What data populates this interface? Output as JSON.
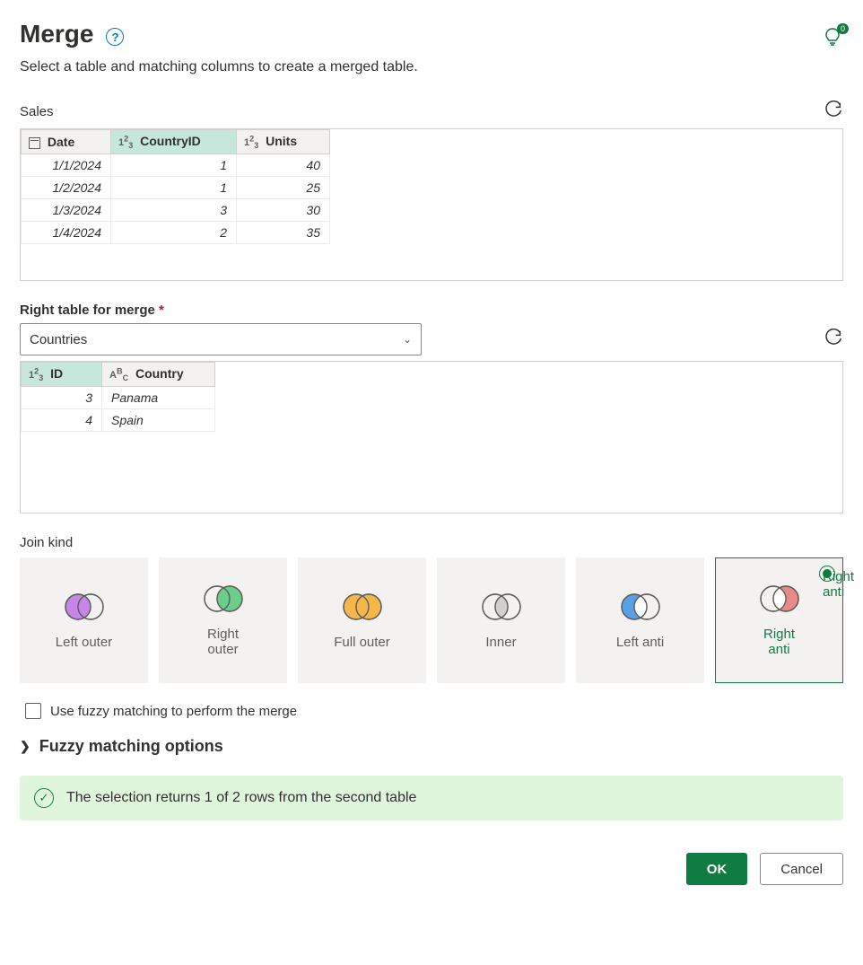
{
  "header": {
    "title": "Merge",
    "subtitle": "Select a table and matching columns to create a merged table.",
    "tip_badge": "0"
  },
  "left_table": {
    "label": "Sales",
    "columns": [
      {
        "name": "Date",
        "type": "date",
        "selected": false
      },
      {
        "name": "CountryID",
        "type": "number",
        "selected": true
      },
      {
        "name": "Units",
        "type": "number",
        "selected": false
      }
    ],
    "rows": [
      {
        "Date": "1/1/2024",
        "CountryID": "1",
        "Units": "40"
      },
      {
        "Date": "1/2/2024",
        "CountryID": "1",
        "Units": "25"
      },
      {
        "Date": "1/3/2024",
        "CountryID": "3",
        "Units": "30"
      },
      {
        "Date": "1/4/2024",
        "CountryID": "2",
        "Units": "35"
      }
    ]
  },
  "right_table_field": {
    "label": "Right table for merge",
    "required": true,
    "value": "Countries"
  },
  "right_table": {
    "columns": [
      {
        "name": "ID",
        "type": "number",
        "selected": true
      },
      {
        "name": "Country",
        "type": "text",
        "selected": false
      }
    ],
    "rows": [
      {
        "ID": "3",
        "Country": "Panama"
      },
      {
        "ID": "4",
        "Country": "Spain"
      }
    ]
  },
  "join": {
    "label": "Join kind",
    "options": [
      {
        "id": "left-outer",
        "label": "Left outer",
        "left_fill": "#c586e8",
        "right_fill": "none",
        "mid_fill": "#c586e8"
      },
      {
        "id": "right-outer",
        "label": "Right outer",
        "left_fill": "none",
        "right_fill": "#6bcf8b",
        "mid_fill": "#6bcf8b"
      },
      {
        "id": "full-outer",
        "label": "Full outer",
        "left_fill": "#f5b64a",
        "right_fill": "#f5b64a",
        "mid_fill": "#f5b64a"
      },
      {
        "id": "inner",
        "label": "Inner",
        "left_fill": "none",
        "right_fill": "none",
        "mid_fill": "#d2d0ce"
      },
      {
        "id": "left-anti",
        "label": "Left anti",
        "left_fill": "#5aa0e6",
        "right_fill": "none",
        "mid_fill": "none"
      },
      {
        "id": "right-anti",
        "label": "Right anti",
        "left_fill": "none",
        "right_fill": "#e88a8a",
        "mid_fill": "none"
      }
    ],
    "selected": "right-anti"
  },
  "fuzzy": {
    "checkbox_label": "Use fuzzy matching to perform the merge",
    "expander_label": "Fuzzy matching options"
  },
  "status": "The selection returns 1 of 2 rows from the second table",
  "footer": {
    "ok": "OK",
    "cancel": "Cancel"
  }
}
